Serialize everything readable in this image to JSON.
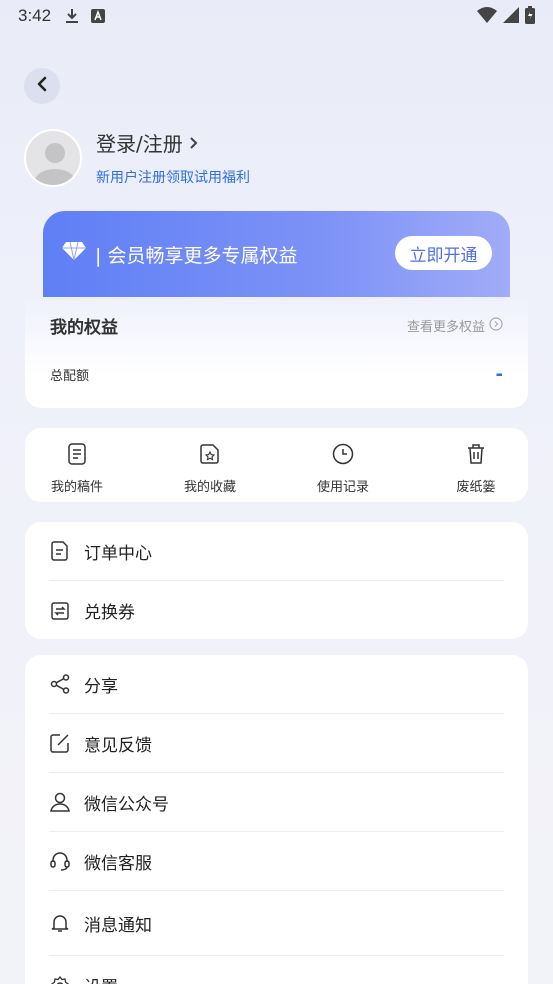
{
  "status_bar": {
    "time": "3:42"
  },
  "profile": {
    "login_title": "登录/注册",
    "subtitle": "新用户注册领取试用福利"
  },
  "vip": {
    "text": "| 会员畅享更多专属权益",
    "button": "立即开通"
  },
  "rights": {
    "title": "我的权益",
    "more": "查看更多权益",
    "total_label": "总配额",
    "total_value": "-"
  },
  "shortcuts": [
    {
      "label": "我的稿件",
      "icon": "document-icon"
    },
    {
      "label": "我的收藏",
      "icon": "favorites-icon"
    },
    {
      "label": "使用记录",
      "icon": "clock-icon"
    },
    {
      "label": "废纸篓",
      "icon": "trash-icon"
    }
  ],
  "menu_group1": [
    {
      "label": "订单中心",
      "icon": "order-icon"
    },
    {
      "label": "兑换券",
      "icon": "coupon-icon"
    }
  ],
  "menu_group2": [
    {
      "label": "分享",
      "icon": "share-icon"
    },
    {
      "label": "意见反馈",
      "icon": "feedback-icon"
    },
    {
      "label": "微信公众号",
      "icon": "user-icon"
    },
    {
      "label": "微信客服",
      "icon": "headset-icon"
    },
    {
      "label": "消息通知",
      "icon": "bell-icon"
    },
    {
      "label": "设置",
      "icon": "gear-icon"
    }
  ],
  "colors": {
    "accent": "#2f6fe0",
    "vip_start": "#5f7ff5",
    "vip_end": "#a1acf7"
  }
}
